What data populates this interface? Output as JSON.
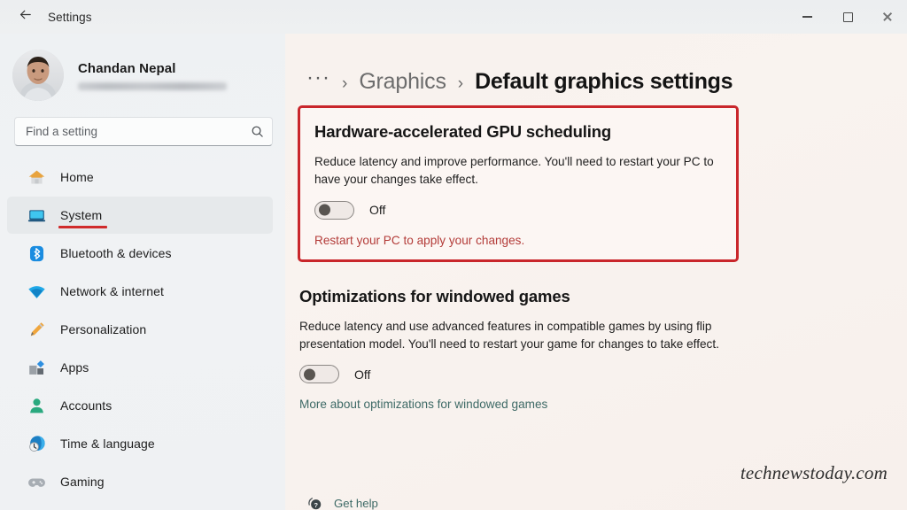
{
  "window": {
    "title": "Settings",
    "back_icon": "back-arrow-icon",
    "minimize_label": "Minimize",
    "maximize_label": "Maximize",
    "close_label": "Close"
  },
  "sidebar": {
    "account": {
      "name": "Chandan Nepal",
      "email": "",
      "email_redacted": true,
      "avatar_alt": "user-photo"
    },
    "search": {
      "placeholder": "Find a setting",
      "value": "",
      "icon": "search-icon"
    },
    "items": [
      {
        "label": "Home",
        "icon": "home-icon",
        "selected": false,
        "annotated": false
      },
      {
        "label": "System",
        "icon": "system-icon",
        "selected": true,
        "annotated": true
      },
      {
        "label": "Bluetooth & devices",
        "icon": "bluetooth-icon",
        "selected": false,
        "annotated": false
      },
      {
        "label": "Network & internet",
        "icon": "network-icon",
        "selected": false,
        "annotated": false
      },
      {
        "label": "Personalization",
        "icon": "personalization-icon",
        "selected": false,
        "annotated": false
      },
      {
        "label": "Apps",
        "icon": "apps-icon",
        "selected": false,
        "annotated": false
      },
      {
        "label": "Accounts",
        "icon": "accounts-icon",
        "selected": false,
        "annotated": false
      },
      {
        "label": "Time & language",
        "icon": "time-language-icon",
        "selected": false,
        "annotated": false
      },
      {
        "label": "Gaming",
        "icon": "gaming-icon",
        "selected": false,
        "annotated": false
      }
    ]
  },
  "main": {
    "breadcrumb": {
      "overflow": "···",
      "separator": "›",
      "parent": "Graphics",
      "current": "Default graphics settings"
    },
    "sections": [
      {
        "title": "Hardware-accelerated GPU scheduling",
        "description": "Reduce latency and improve performance. You'll need to restart your PC to have your changes take effect.",
        "toggle_state": "Off",
        "notice": "Restart your PC to apply your changes.",
        "highlighted": true
      },
      {
        "title": "Optimizations for windowed games",
        "description": "Reduce latency and use advanced features in compatible games by using flip presentation model. You'll need to restart your game for changes to take effect.",
        "toggle_state": "Off",
        "link": "More about optimizations for windowed games",
        "highlighted": false
      }
    ],
    "get_help": {
      "label": "Get help",
      "icon": "help-icon"
    }
  },
  "watermark": "technewstoday.com",
  "colors": {
    "annotation_red": "#c9262b",
    "notice_red": "#b33b38",
    "link_teal": "#3e6a66",
    "selection_accent": "#2f6e5c",
    "sidebar_bg": "#eef1f3",
    "main_bg": "#faf3ef"
  }
}
